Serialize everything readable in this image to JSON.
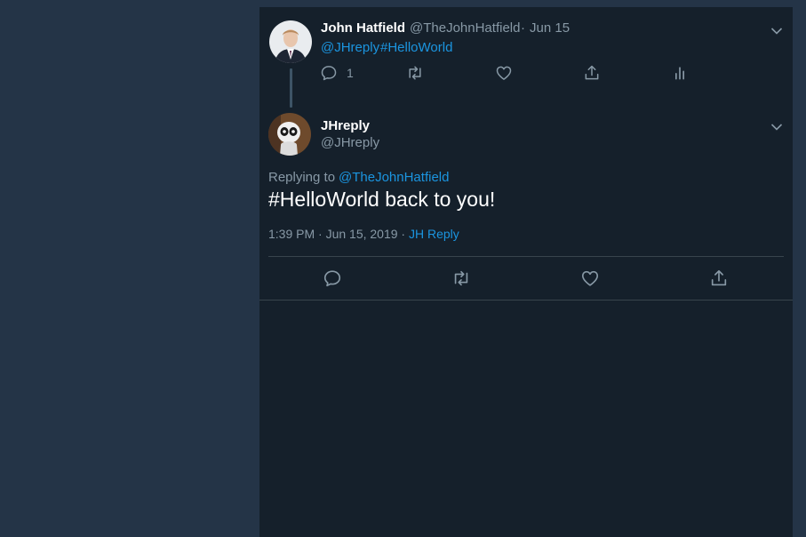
{
  "parent_tweet": {
    "author_name": "John Hatfield",
    "author_handle": "@TheJohnHatfield",
    "separator": "·",
    "date": "Jun 15",
    "body": {
      "mention": "@JHreply",
      "hashtag": "#HelloWorld"
    },
    "actions": {
      "reply_icon": "reply-icon",
      "reply_count": "1",
      "retweet_icon": "retweet-icon",
      "like_icon": "heart-icon",
      "share_icon": "share-icon",
      "analytics_icon": "analytics-icon"
    }
  },
  "reply_tweet": {
    "author_name": "JHreply",
    "author_handle": "@JHreply",
    "replying_to_label": "Replying to",
    "replying_to_handle": "@TheJohnHatfield",
    "text": "#HelloWorld back to you!",
    "timestamp": "1:39 PM · Jun 15, 2019",
    "source_separator": " · ",
    "source": "JH Reply",
    "actions": {
      "reply_icon": "reply-icon",
      "retweet_icon": "retweet-icon",
      "like_icon": "heart-icon",
      "share_icon": "share-icon"
    }
  },
  "colors": {
    "page_background": "#243447",
    "panel_background": "#15202b",
    "link_blue": "#1b95e0",
    "muted_text": "#8899a6",
    "divider": "#38444d"
  }
}
